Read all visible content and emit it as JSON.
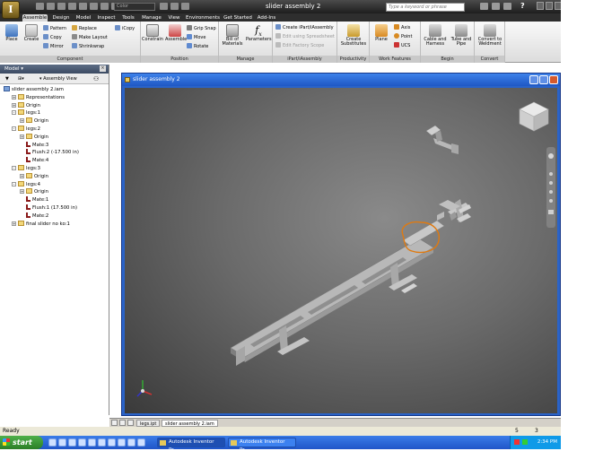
{
  "app": {
    "title": "slider assembly 2",
    "app_letter": "I",
    "color_combo": "Color",
    "search_placeholder": "Type a keyword or phrase",
    "help_icon": "?"
  },
  "tabs": [
    "Assemble",
    "Design",
    "Model",
    "Inspect",
    "Tools",
    "Manage",
    "View",
    "Environments",
    "Get Started",
    "Add-Ins"
  ],
  "active_tab": "Assemble",
  "ribbon": {
    "component": {
      "label": "Component",
      "place": "Place",
      "create": "Create",
      "pattern": "Pattern",
      "copy": "Copy",
      "mirror": "Mirror",
      "replace": "Replace",
      "make_layout": "Make Layout",
      "shrinkwrap": "Shrinkwrap",
      "icopy": "iCopy"
    },
    "position": {
      "label": "Position",
      "constrain": "Constrain",
      "assemble": "Assemble",
      "grip_snap": "Grip Snap",
      "move": "Move",
      "rotate": "Rotate"
    },
    "manage": {
      "label": "Manage",
      "bill_of_materials_1": "Bill of",
      "bill_of_materials_2": "Materials",
      "parameters": "Parameters"
    },
    "ipart": {
      "label": "iPart/iAssembly",
      "create": "Create iPart/iAssembly",
      "edit_spreadsheet": "Edit using Spreadsheet",
      "edit_factory": "Edit Factory Scope"
    },
    "productivity": {
      "label": "Productivity",
      "create_substitutes_1": "Create",
      "create_substitutes_2": "Substitutes"
    },
    "work_features": {
      "label": "Work Features",
      "plane": "Plane",
      "axis": "Axis",
      "point": "Point",
      "ucs": "UCS"
    },
    "begin": {
      "label": "Begin",
      "cable_1": "Cable and",
      "cable_2": "Harness",
      "tube_1": "Tube and",
      "tube_2": "Pipe"
    },
    "convert": {
      "label": "Convert",
      "convert_1": "Convert to",
      "convert_2": "Weldment"
    }
  },
  "browser": {
    "title": "Model",
    "view_label": "Assembly View",
    "tree": [
      {
        "label": "slider assembly 2.iam",
        "indent": 0,
        "icon": "assembly",
        "expander": ""
      },
      {
        "label": "Representations",
        "indent": 1,
        "icon": "folder",
        "expander": "+"
      },
      {
        "label": "Origin",
        "indent": 1,
        "icon": "folder",
        "expander": "+"
      },
      {
        "label": "legs:1",
        "indent": 1,
        "icon": "part",
        "expander": "-"
      },
      {
        "label": "Origin",
        "indent": 2,
        "icon": "folder",
        "expander": "+"
      },
      {
        "label": "legs:2",
        "indent": 1,
        "icon": "part",
        "expander": "-"
      },
      {
        "label": "Origin",
        "indent": 2,
        "icon": "folder",
        "expander": "+"
      },
      {
        "label": "Mate:3",
        "indent": 2,
        "icon": "mate",
        "expander": ""
      },
      {
        "label": "Flush:2 (-17.500 in)",
        "indent": 2,
        "icon": "mate",
        "expander": ""
      },
      {
        "label": "Mate:4",
        "indent": 2,
        "icon": "mate",
        "expander": ""
      },
      {
        "label": "legs:3",
        "indent": 1,
        "icon": "part",
        "expander": "-"
      },
      {
        "label": "Origin",
        "indent": 2,
        "icon": "folder",
        "expander": "+"
      },
      {
        "label": "legs:4",
        "indent": 1,
        "icon": "part",
        "expander": "-"
      },
      {
        "label": "Origin",
        "indent": 2,
        "icon": "folder",
        "expander": "+"
      },
      {
        "label": "Mate:1",
        "indent": 2,
        "icon": "mate",
        "expander": ""
      },
      {
        "label": "Flush:1 (17.500 in)",
        "indent": 2,
        "icon": "mate",
        "expander": ""
      },
      {
        "label": "Mate:2",
        "indent": 2,
        "icon": "mate",
        "expander": ""
      },
      {
        "label": "final slider no ko:1",
        "indent": 1,
        "icon": "part",
        "expander": "+"
      }
    ]
  },
  "document": {
    "title": "slider assembly 2"
  },
  "doc_tabs": [
    "legs.ipt",
    "slider assembly 2.iam"
  ],
  "status": {
    "text": "Ready",
    "count_a": "5",
    "count_b": "3"
  },
  "taskbar": {
    "start": "start",
    "tasks": [
      "Autodesk Inventor Pr...",
      "Autodesk Inventor Pr..."
    ],
    "clock": "2:34 PM"
  },
  "colors": {
    "title_bar": "#2a2a2a",
    "doc_frame": "#2a63c8",
    "selection_highlight": "#e07a10",
    "taskbar": "#2a62d2"
  }
}
